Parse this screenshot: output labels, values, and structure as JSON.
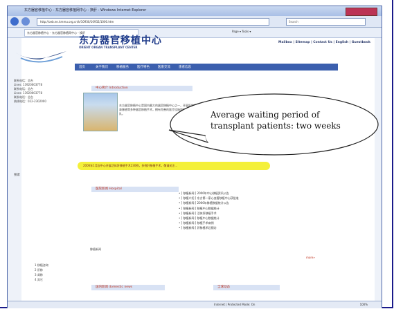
{
  "browser": {
    "title": "东方器官移植中心 - 东方器官移植网中心 - 换肝 - Windows Internet Explorer",
    "url": "http://oeb.en.kmmu.org.cn/k/10930/10932/1000.htm",
    "search_placeholder": "Search",
    "tab_label": "东方器官移植中心 - 东方器官移植网中心 - 换肝",
    "toolbar_right": "Page ▾  Tools ▾",
    "status_text": "Internet | Protected Mode: On",
    "zoom": "100%"
  },
  "page": {
    "toplinks": "Mailbox | Sitemap | Contact Us | English | Guestbook",
    "site_title": "东方器官移植中心",
    "site_subtitle": "ORIENT ORGAN TRANSPLANT CENTER",
    "nav_items": [
      "首页",
      "关于我们",
      "移植服务",
      "医疗特色",
      "医患交流",
      "患者信息"
    ],
    "section_intro": "中心简介 Introduction",
    "section_news": "医院新闻 Hospital",
    "section_bottom_left": "国内新闻 domestic news",
    "section_bottom_right": "全球动态",
    "red_number": "1000",
    "highlight_text": "2006年1月起中心开展活体肝移植手术230例，多例肝移植手术，敬请关注...",
    "left_labels": [
      "联系电话：总台",
      "Lines: 13920003778",
      "联系电话：总台",
      "Lines: 13920003778",
      "联系电话：总台",
      "热线电话：022-2302000"
    ],
    "left_search_label": "搜索",
    "list_items": [
      "• [ 移植新闻 ] 2006年中心移植资讯公告",
      "• [ 移植介绍 ] 东方第一家心血管移植中心获批准",
      "• [ 移植新闻 ] 2006年移植数据统计公告",
      "• [ 移植新闻 ] 移植中心数据统计",
      "• [ 移植新闻 ] 活体肝移植手术",
      "• [ 移植新闻 ] 移植中心数据统计",
      "• [ 移植新闻 ] 移植手术病例",
      "• [ 移植新闻 ] 肝移植术后随访"
    ],
    "news_label": "移植新闻",
    "more_link": "more»",
    "radio_options": [
      "1 移植咨询",
      "2 肝移",
      "3 肾移",
      "4 其它"
    ]
  },
  "callout": {
    "line1": "Average waiting period of",
    "line2": "transplant patients: two weeks"
  }
}
